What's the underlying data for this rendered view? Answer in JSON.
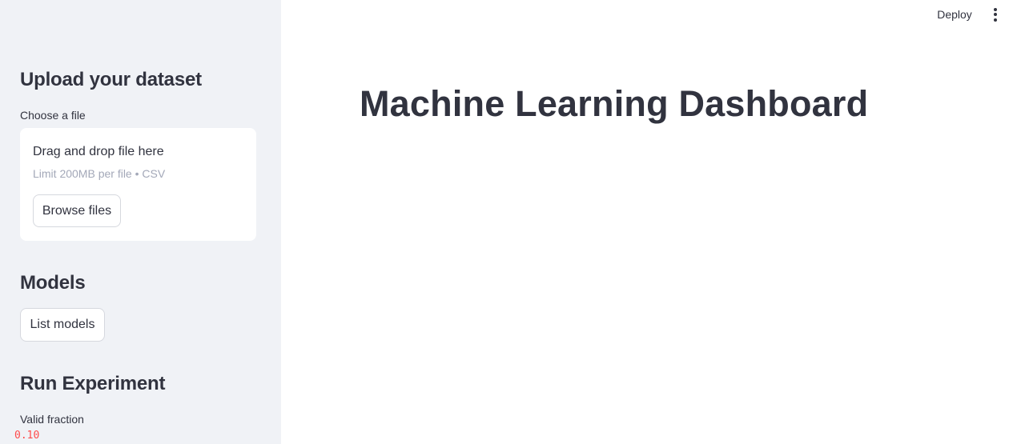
{
  "header": {
    "deploy_label": "Deploy",
    "menu_icon": "more-vertical-icon"
  },
  "main": {
    "title": "Machine Learning Dashboard"
  },
  "sidebar": {
    "upload_heading": "Upload your dataset",
    "file_label": "Choose a file",
    "dropzone": {
      "title": "Drag and drop file here",
      "subtitle": "Limit 200MB per file • CSV",
      "browse_label": "Browse files"
    },
    "models_heading": "Models",
    "list_models_label": "List models",
    "experiment_heading": "Run Experiment",
    "valid_fraction_label": "Valid fraction",
    "valid_fraction_value": "0.10"
  },
  "colors": {
    "sidebar_bg": "#f0f2f6",
    "text": "#31333f",
    "accent": "#ff4b4b"
  }
}
